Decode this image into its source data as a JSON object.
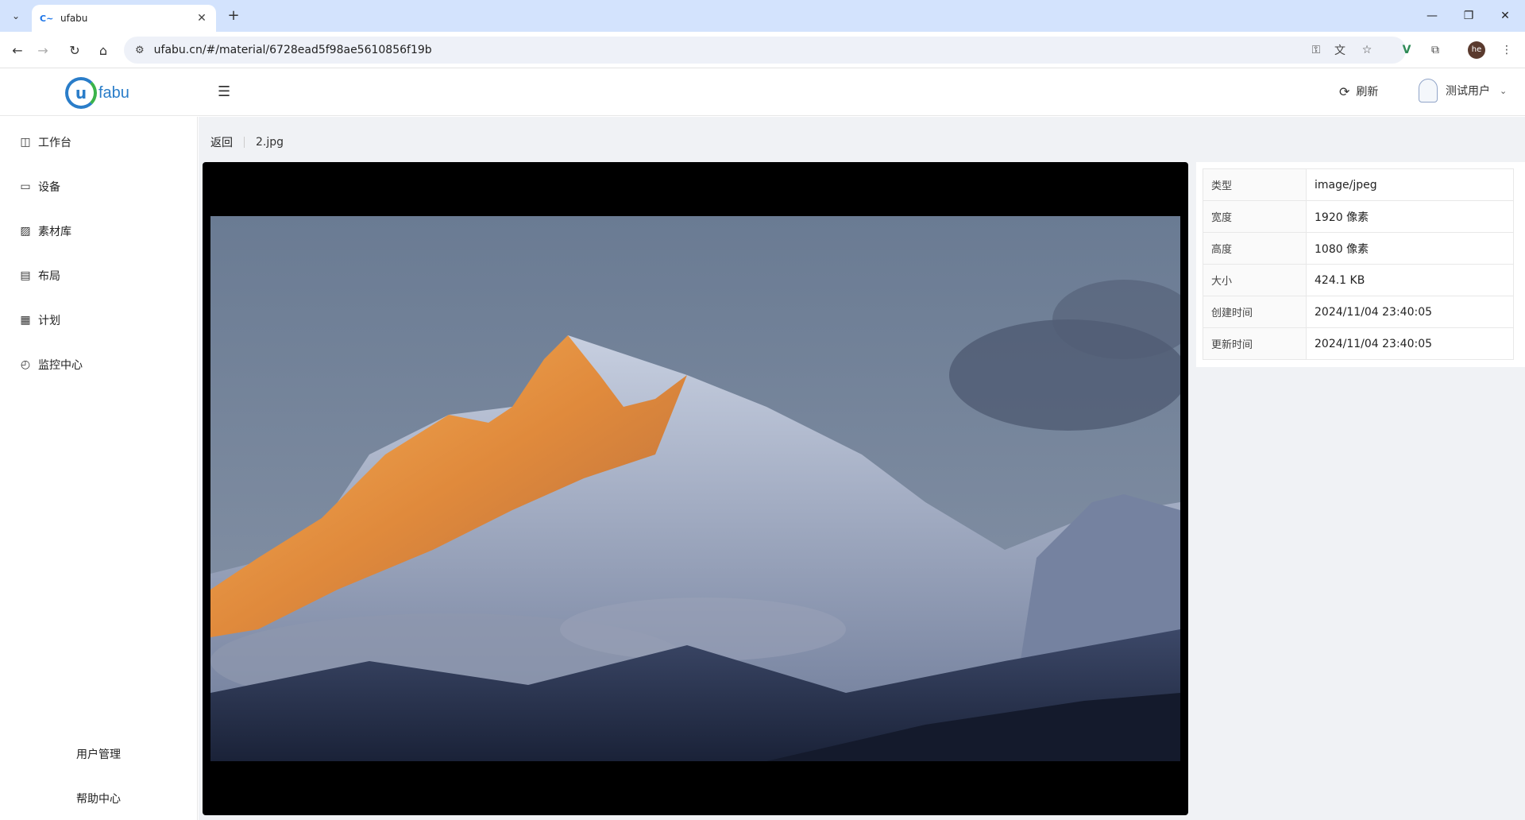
{
  "browser": {
    "tab_title": "ufabu",
    "url": "ufabu.cn/#/material/6728ead5f98ae5610856f19b",
    "profile_initials": "he"
  },
  "header": {
    "brand_letter": "u",
    "brand_name": "fabu",
    "refresh_label": "刷新",
    "user_name": "测试用户"
  },
  "sidebar": {
    "items": [
      {
        "label": "工作台",
        "icon": "dashboard-icon"
      },
      {
        "label": "设备",
        "icon": "monitor-icon"
      },
      {
        "label": "素材库",
        "icon": "image-icon"
      },
      {
        "label": "布局",
        "icon": "layout-icon"
      },
      {
        "label": "计划",
        "icon": "calendar-icon"
      },
      {
        "label": "监控中心",
        "icon": "pulse-icon"
      }
    ],
    "bottom": {
      "user_mgmt": "用户管理",
      "help": "帮助中心"
    }
  },
  "main": {
    "back_label": "返回",
    "file_name": "2.jpg",
    "info": [
      {
        "key": "类型",
        "value": "image/jpeg"
      },
      {
        "key": "宽度",
        "value": "1920 像素"
      },
      {
        "key": "高度",
        "value": "1080 像素"
      },
      {
        "key": "大小",
        "value": "424.1 KB"
      },
      {
        "key": "创建时间",
        "value": "2024/11/04 23:40:05"
      },
      {
        "key": "更新时间",
        "value": "2024/11/04 23:40:05"
      }
    ]
  },
  "colors": {
    "accent": "#2a7dc9",
    "brand_green": "#3bb34a"
  }
}
